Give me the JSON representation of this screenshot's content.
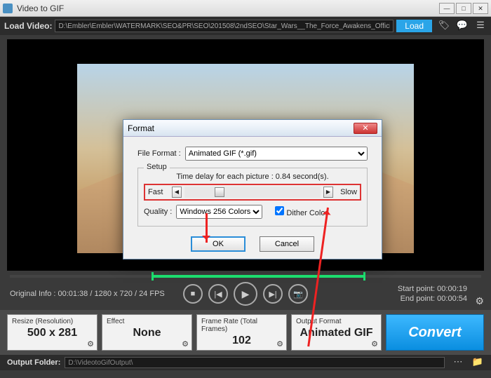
{
  "window": {
    "title": "Video to GIF"
  },
  "loadbar": {
    "label": "Load Video:",
    "path": "D:\\Embler\\Embler\\WATERMARK\\SEO&PR\\SEO\\201508\\2ndSEO\\Star_Wars__The_Force_Awakens_Official_Te",
    "button": "Load"
  },
  "orig_info": "Original Info : 00:01:38 / 1280 x 720 / 24 FPS",
  "points": {
    "start": "Start point: 00:00:19",
    "end": "End point: 00:00:54"
  },
  "cards": {
    "resize": {
      "title": "Resize (Resolution)",
      "value": "500 x 281"
    },
    "effect": {
      "title": "Effect",
      "value": "None"
    },
    "frames": {
      "title": "Frame Rate (Total Frames)",
      "value": "102"
    },
    "format": {
      "title": "Output Format",
      "value": "Animated GIF"
    }
  },
  "convert": "Convert",
  "output": {
    "label": "Output Folder:",
    "path": "D:\\VideotoGifOutput\\"
  },
  "dialog": {
    "title": "Format",
    "filefmt_label": "File Format :",
    "filefmt_value": "Animated GIF (*.gif)",
    "setup_legend": "Setup",
    "delay_text": "Time delay for each picture : 0.84 second(s).",
    "fast": "Fast",
    "slow": "Slow",
    "quality_label": "Quality :",
    "quality_value": "Windows 256 Colors",
    "dither": "Dither Color",
    "ok": "OK",
    "cancel": "Cancel"
  }
}
